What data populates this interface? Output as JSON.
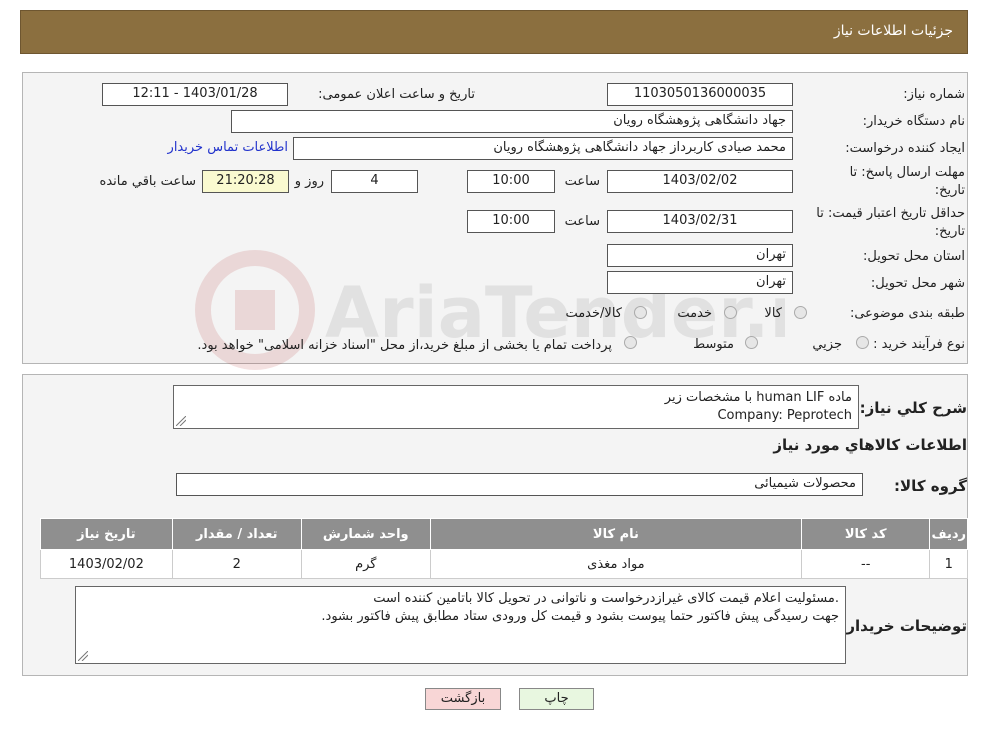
{
  "header": {
    "title": "جزئیات اطلاعات نیاز"
  },
  "watermark": {
    "text": "AriaTender.neT"
  },
  "form": {
    "need_number": {
      "label": "شماره نیاز:",
      "value": "1103050136000035"
    },
    "announce": {
      "label": "تاریخ و ساعت اعلان عمومی:",
      "value": "1403/01/28 - 12:11"
    },
    "buyer_org": {
      "label": "نام دستگاه خریدار:",
      "value": "جهاد دانشگاهی پژوهشگاه رویان"
    },
    "creator": {
      "label": "ایجاد کننده درخواست:",
      "value": "محمد صیادی کاربرداز جهاد دانشگاهی پژوهشگاه رویان"
    },
    "contact_link": "اطلاعات تماس خریدار",
    "deadline": {
      "label_line1": "مهلت ارسال پاسخ: تا",
      "label_line2": "تاریخ:",
      "date": "1403/02/02",
      "time_label": "ساعت",
      "time": "10:00",
      "days": "4",
      "days_label": "روز و",
      "remaining": "21:20:28",
      "remaining_label": "ساعت باقي مانده"
    },
    "validity": {
      "label_line1": "حداقل تاریخ اعتبار قیمت: تا",
      "label_line2": "تاریخ:",
      "date": "1403/02/31",
      "time_label": "ساعت",
      "time": "10:00"
    },
    "province": {
      "label": "استان محل تحویل:",
      "value": "تهران"
    },
    "city": {
      "label": "شهر محل تحویل:",
      "value": "تهران"
    },
    "category": {
      "label": "طبقه بندی موضوعی:",
      "options": [
        "کالا",
        "خدمت",
        "کالا/خدمت"
      ]
    },
    "purchase_type": {
      "label": "نوع فرآیند خرید :",
      "options": [
        "جزیي",
        "متوسط"
      ],
      "note": "پرداخت تمام یا بخشی از مبلغ خرید،از محل \"اسناد خزانه اسلامی\" خواهد بود."
    }
  },
  "summary": {
    "label": "شرح كلي نياز:",
    "line1": "ماده human LIF با مشخصات زیر",
    "line2": "Company: Peprotech"
  },
  "goods_info_title": "اطلاعات كالاهاي مورد نياز",
  "goods_group": {
    "label": "گروه کالا:",
    "value": "محصولات شیمیائی"
  },
  "table": {
    "headers": [
      "ردیف",
      "کد کالا",
      "نام کالا",
      "واحد شمارش",
      "تعداد / مقدار",
      "تاریخ نیاز"
    ],
    "rows": [
      [
        "1",
        "--",
        "مواد مغذی",
        "گرم",
        "2",
        "1403/02/02"
      ]
    ]
  },
  "buyer_notes": {
    "label": "توضیحات خریدار:",
    "line1": ".مسئولیت اعلام قیمت کالای غیرازدرخواست و ناتوانی در تحویل کالا باتامین کننده است",
    "line2": "جهت رسیدگی پیش فاکتور حتما پیوست بشود و قیمت کل ورودی ستاد مطابق پیش فاکتور بشود."
  },
  "buttons": {
    "print": "چاپ",
    "back": "بازگشت"
  },
  "colors": {
    "header": "#8b6f3f",
    "table_header": "#8f8f8f",
    "back_button": "#f8d6d6",
    "print_button": "#e8f7e0",
    "link": "#2233cc"
  }
}
